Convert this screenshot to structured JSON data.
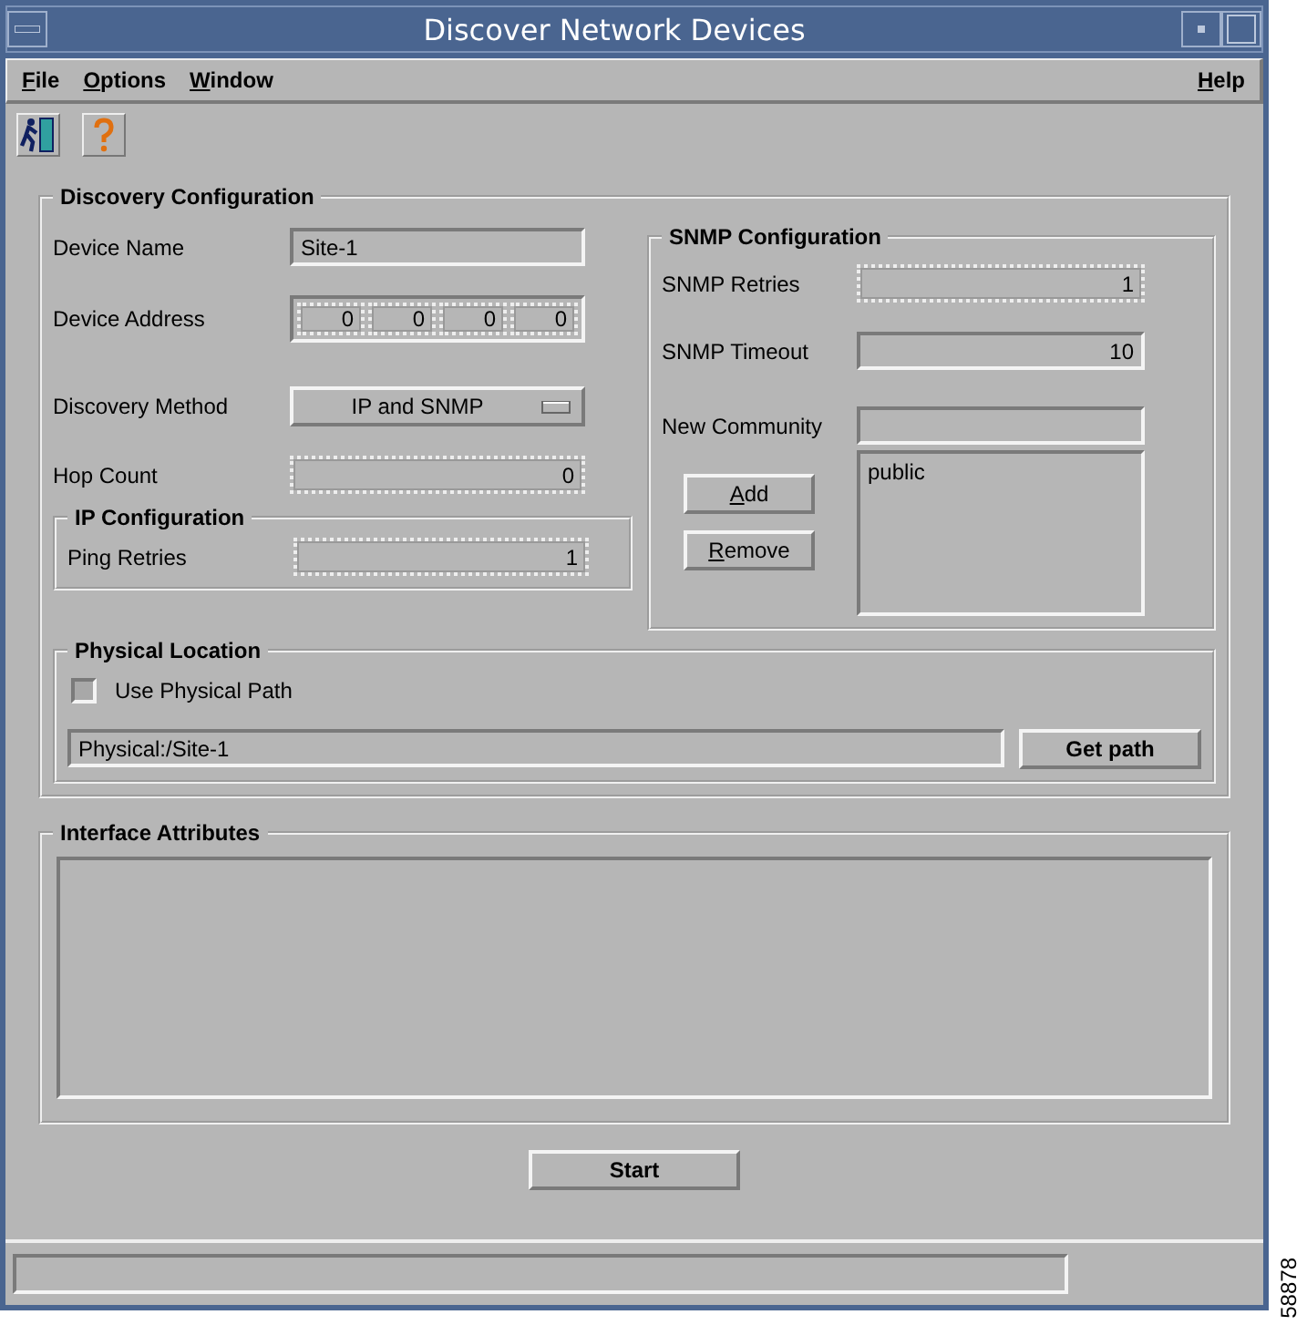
{
  "window": {
    "title": "Discover Network Devices"
  },
  "menus": [
    {
      "label": "File"
    },
    {
      "label": "Options"
    },
    {
      "label": "Window"
    }
  ],
  "help_menu": {
    "label": "Help"
  },
  "discovery_configuration": {
    "title": "Discovery Configuration",
    "fields": [
      {
        "kind": "text",
        "label": "Device Name",
        "value": "Site-1",
        "disabled": false
      },
      {
        "kind": "address",
        "label": "Device Address",
        "octets": [
          "0",
          "0",
          "0",
          "0"
        ],
        "disabled": true
      },
      {
        "kind": "dropdown",
        "label": "Discovery Method",
        "value": "IP and SNMP"
      },
      {
        "kind": "number",
        "label": "Hop Count",
        "value": "0",
        "disabled": true
      }
    ],
    "ip_configuration": {
      "title": "IP Configuration",
      "fields": [
        {
          "kind": "number",
          "label": "Ping Retries",
          "value": "1",
          "disabled": true
        }
      ]
    },
    "snmp_configuration": {
      "title": "SNMP Configuration",
      "fields": [
        {
          "kind": "number",
          "label": "SNMP Retries",
          "value": "1",
          "disabled": true
        },
        {
          "kind": "number",
          "label": "SNMP Timeout",
          "value": "10",
          "disabled": false
        },
        {
          "kind": "text",
          "label": "New Community",
          "disabled": false
        }
      ],
      "buttons": [
        "Add",
        "Remove"
      ],
      "communities": [
        "public"
      ]
    },
    "physical_location": {
      "title": "Physical Location",
      "use_physical_path": {
        "label": "Use Physical Path",
        "checked": false
      },
      "path": "Physical:/Site-1",
      "button": "Get path"
    }
  },
  "interface_attributes": {
    "title": "Interface Attributes"
  },
  "start_button": "Start",
  "figure_number": "58878"
}
